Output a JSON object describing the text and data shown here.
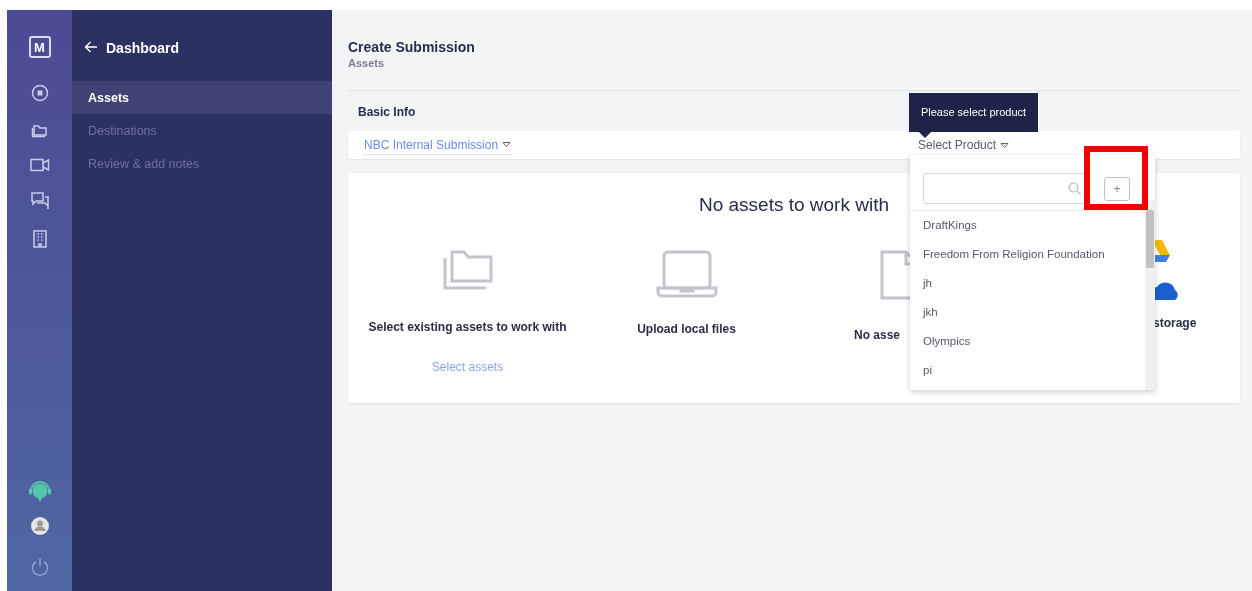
{
  "rail": {
    "logo": "M"
  },
  "sidebar": {
    "back": "Dashboard",
    "items": [
      {
        "label": "Assets",
        "selected": true
      },
      {
        "label": "Destinations",
        "selected": false
      },
      {
        "label": "Review & add notes",
        "selected": false
      }
    ]
  },
  "page": {
    "title": "Create Submission",
    "subtitle": "Assets"
  },
  "basic_info": {
    "heading": "Basic Info",
    "submission_type": "NBC Internal Submission",
    "product": "Select Product"
  },
  "tooltip": "Please select product",
  "assets_card": {
    "title": "No assets to work with",
    "options": [
      {
        "kind": "folder",
        "label": "Select existing assets to work with",
        "link": "Select assets"
      },
      {
        "kind": "laptop",
        "label": "Upload local files"
      },
      {
        "kind": "document",
        "label": "No asse"
      },
      {
        "kind": "cloud",
        "label": "storage"
      }
    ]
  },
  "product_dropdown": {
    "add_button": "+",
    "items": [
      {
        "label": "DraftKings"
      },
      {
        "label": "Freedom From Religion Foundation"
      },
      {
        "label": "jh"
      },
      {
        "label": "jkh"
      },
      {
        "label": "Olympics"
      },
      {
        "label": "pi"
      }
    ]
  }
}
